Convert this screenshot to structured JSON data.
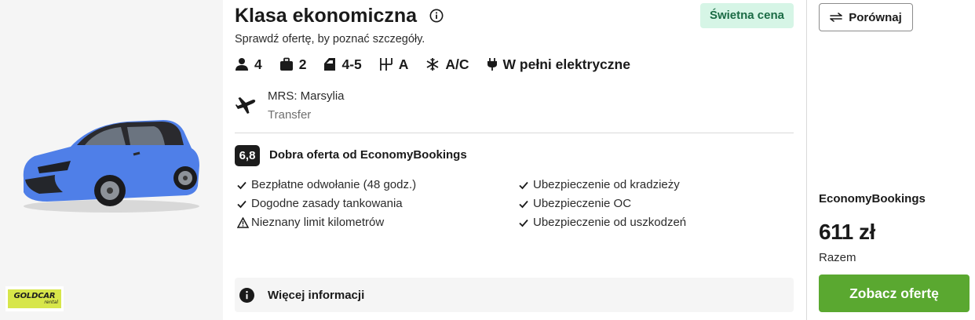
{
  "car": {
    "title": "Klasa ekonomiczna",
    "subtitle": "Sprawdź ofertę, by poznać szczegóły.",
    "badge": "Świetna cena",
    "features": [
      {
        "icon": "person-icon",
        "value": "4"
      },
      {
        "icon": "suitcase-icon",
        "value": "2"
      },
      {
        "icon": "car-door-icon",
        "value": "4-5"
      },
      {
        "icon": "gearshift-icon",
        "value": "A"
      },
      {
        "icon": "snowflake-icon",
        "value": "A/C"
      },
      {
        "icon": "plug-icon",
        "value": "W pełni elektryczne"
      }
    ],
    "image_color": "#4f7fe8"
  },
  "location": {
    "icon": "plane-icon",
    "name": "MRS: Marsylia",
    "type": "Transfer"
  },
  "rating": {
    "score": "6,8",
    "label": "Dobra oferta od EconomyBookings"
  },
  "benefits": {
    "left": [
      {
        "icon": "check-icon",
        "text": "Bezpłatne odwołanie (48 godz.)"
      },
      {
        "icon": "check-icon",
        "text": "Dogodne zasady tankowania"
      },
      {
        "icon": "warning-icon",
        "text": "Nieznany limit kilometrów"
      }
    ],
    "right": [
      {
        "icon": "check-icon",
        "text": "Ubezpieczenie od kradzieży"
      },
      {
        "icon": "check-icon",
        "text": "Ubezpieczenie OC"
      },
      {
        "icon": "check-icon",
        "text": "Ubezpieczenie od uszkodzeń"
      }
    ]
  },
  "more_info": {
    "label": "Więcej informacji"
  },
  "supplier": {
    "logo_text": "GOLDCAR",
    "logo_sub": "rental",
    "logo_color": "#d7e64a"
  },
  "sidebar": {
    "compare_label": "Porównaj",
    "provider": "EconomyBookings",
    "price": "611 zł",
    "price_note": "Razem",
    "cta_label": "Zobacz ofertę",
    "cta_color": "#5aa830"
  },
  "colors": {
    "badge_bg": "#d6f5e6",
    "badge_text": "#1b6b45",
    "score_bg": "#1c1c1c"
  }
}
